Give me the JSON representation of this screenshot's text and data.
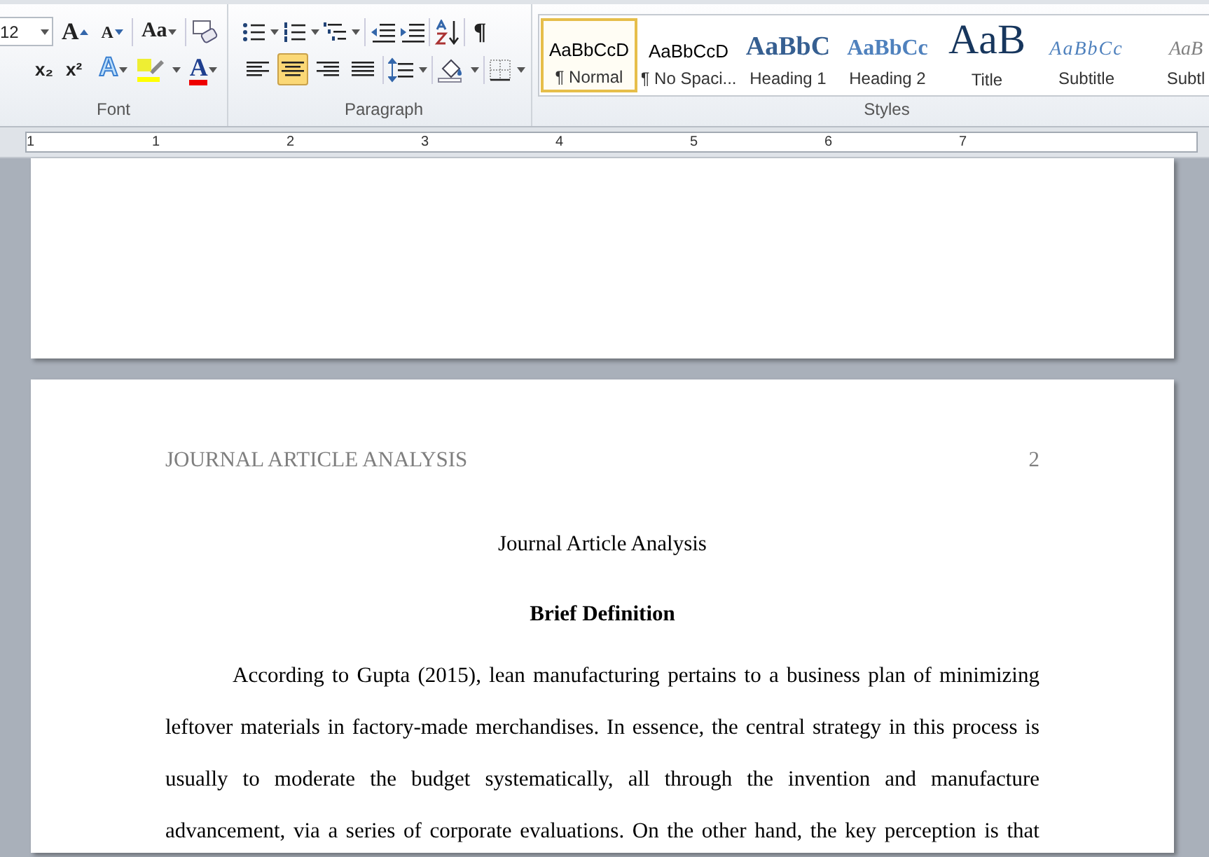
{
  "ribbon": {
    "font_group": {
      "label": "Font",
      "font_size": "12",
      "row1": [
        {
          "kind": "grow",
          "glyph": "A"
        },
        {
          "kind": "shrink",
          "glyph": "A"
        },
        {
          "kind": "case",
          "glyph": "Aa"
        },
        {
          "kind": "clear"
        }
      ],
      "row2": [
        {
          "kind": "sub",
          "glyph": "x₂"
        },
        {
          "kind": "sup",
          "glyph": "x²"
        },
        {
          "kind": "effects",
          "glyph": "A"
        },
        {
          "kind": "highlight"
        },
        {
          "kind": "color",
          "glyph": "A"
        }
      ]
    },
    "paragraph_group": {
      "label": "Paragraph",
      "row1": [
        {
          "kind": "bullets"
        },
        {
          "kind": "numbering"
        },
        {
          "kind": "multilevel"
        },
        {
          "kind": "outdent"
        },
        {
          "kind": "indent"
        },
        {
          "kind": "sort"
        },
        {
          "kind": "pilcrow",
          "glyph": "¶"
        }
      ],
      "alignments": [
        {
          "kind": "left",
          "selected": false
        },
        {
          "kind": "center",
          "selected": true
        },
        {
          "kind": "right",
          "selected": false
        },
        {
          "kind": "justify",
          "selected": false
        }
      ],
      "row2": [
        {
          "kind": "spacing"
        },
        {
          "kind": "shading"
        },
        {
          "kind": "borders"
        }
      ]
    },
    "styles_group": {
      "label": "Styles",
      "items": [
        {
          "kind": "normal",
          "preview": "AaBbCcD",
          "label": "¶ Normal",
          "selected": true
        },
        {
          "kind": "normal",
          "preview": "AaBbCcD",
          "label": "¶ No Spaci...",
          "selected": false
        },
        {
          "kind": "heading1",
          "preview": "AaBbC",
          "label": "Heading 1",
          "selected": false
        },
        {
          "kind": "heading2",
          "preview": "AaBbCc",
          "label": "Heading 2",
          "selected": false
        },
        {
          "kind": "title",
          "preview": "AaB",
          "label": "Title",
          "selected": false
        },
        {
          "kind": "subtitle",
          "preview": "AaBbCc",
          "label": "Subtitle",
          "selected": false
        },
        {
          "kind": "subtle",
          "preview": "AaB",
          "label": "Subtl",
          "selected": false
        }
      ]
    }
  },
  "ruler": {
    "numbers": [
      "1",
      "1",
      "2",
      "3",
      "4",
      "5",
      "6",
      "7"
    ]
  },
  "document": {
    "header": "JOURNAL ARTICLE ANALYSIS",
    "page_number": "2",
    "title": "Journal Article Analysis",
    "heading": "Brief Definition",
    "paragraph_lines": [
      "According to Gupta (2015), lean manufacturing pertains to a business plan of minimizing",
      "leftover materials in factory-made merchandises. In essence, the central strategy in this process is",
      "usually to moderate the budget systematically, all through the invention and manufacture",
      "advancement, via a series of corporate evaluations. On the other hand, the key perception is that"
    ]
  }
}
